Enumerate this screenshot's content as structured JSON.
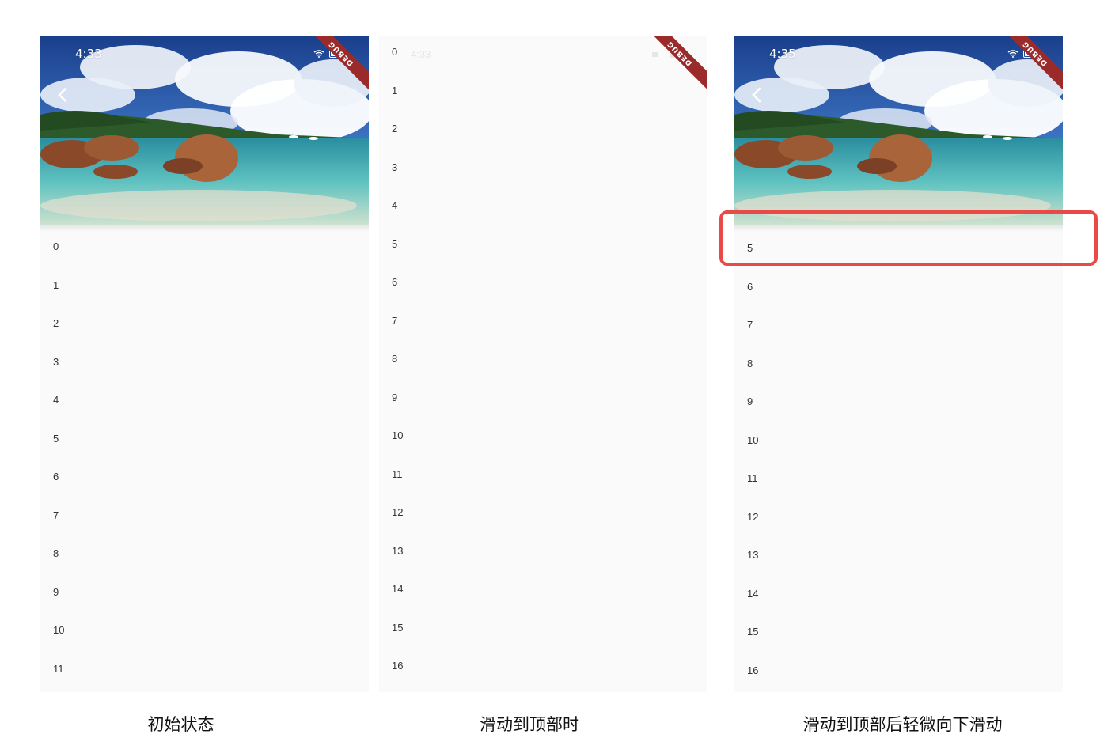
{
  "panels": [
    {
      "status_time": "4:33",
      "debug_label": "DEBUG",
      "items": [
        "0",
        "1",
        "2",
        "3",
        "4",
        "5",
        "6",
        "7",
        "8",
        "9",
        "10",
        "11"
      ],
      "caption": "初始状态"
    },
    {
      "status_time": "4:33",
      "debug_label": "DEBUG",
      "items": [
        "0",
        "1",
        "2",
        "3",
        "4",
        "5",
        "6",
        "7",
        "8",
        "9",
        "10",
        "11",
        "12",
        "13",
        "14",
        "15",
        "16"
      ],
      "caption": "滑动到顶部时"
    },
    {
      "status_time": "4:35",
      "debug_label": "DEBUG",
      "items": [
        "5",
        "6",
        "7",
        "8",
        "9",
        "10",
        "11",
        "12",
        "13",
        "14",
        "15",
        "16"
      ],
      "caption": "滑动到顶部后轻微向下滑动"
    }
  ],
  "colors": {
    "highlight": "#ea4a46",
    "debug_ribbon": "#9b2b2b",
    "background": "#fafafa"
  },
  "icons": [
    "chevron-left-icon",
    "wifi-icon",
    "battery-icon"
  ]
}
